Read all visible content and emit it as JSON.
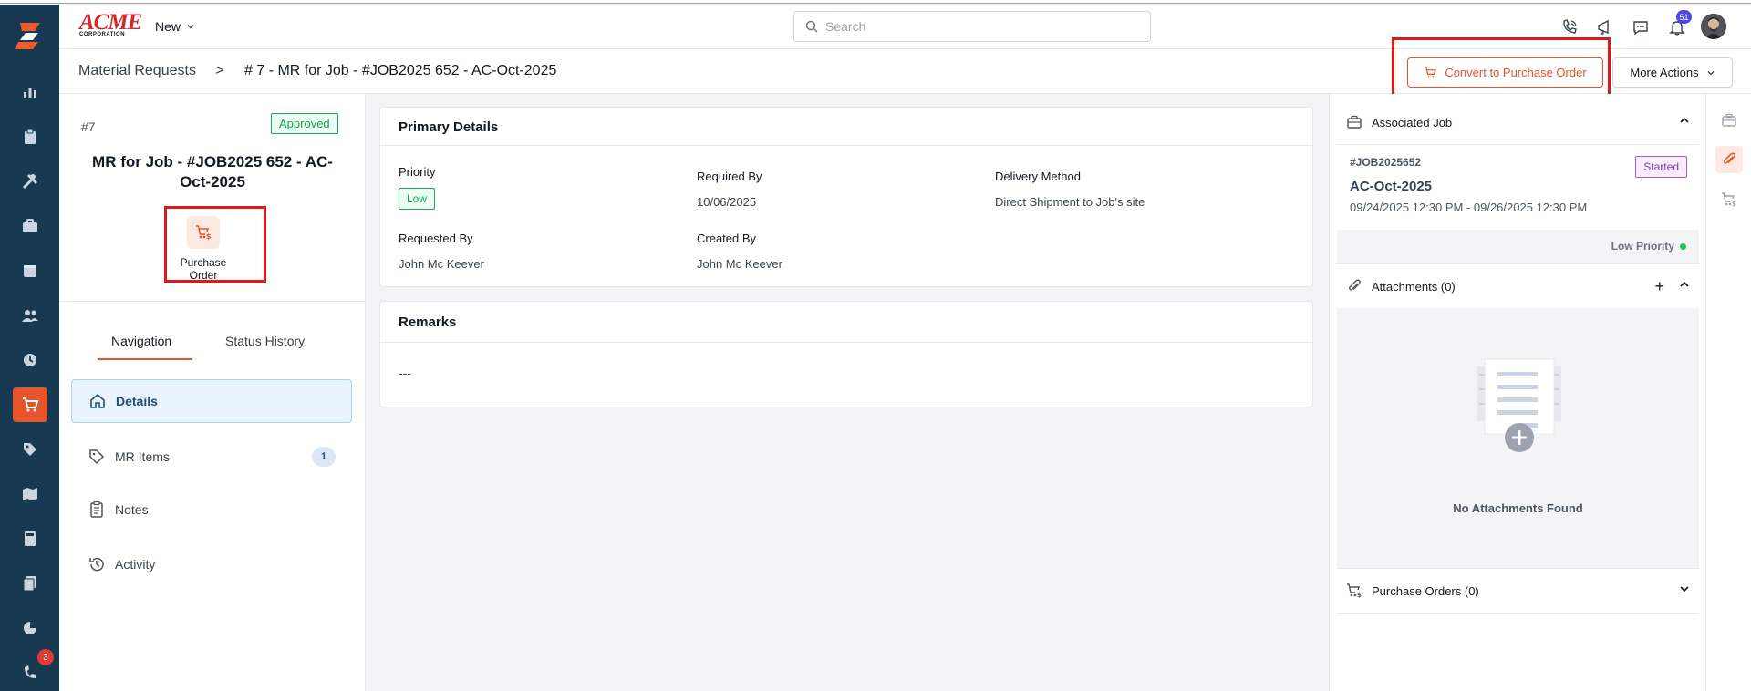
{
  "header": {
    "brand_name": "ACME",
    "brand_sub": "CORPORATION",
    "new_label": "New",
    "search_placeholder": "Search",
    "notification_count": "51"
  },
  "sidebar": {
    "items": [
      {
        "icon": "chart-icon"
      },
      {
        "icon": "clipboard-icon"
      },
      {
        "icon": "tools-icon"
      },
      {
        "icon": "briefcase-icon"
      },
      {
        "icon": "calendar-icon"
      },
      {
        "icon": "users-icon"
      },
      {
        "icon": "clock-icon"
      },
      {
        "icon": "cart-icon",
        "active": true
      },
      {
        "icon": "tag-icon"
      },
      {
        "icon": "map-icon"
      },
      {
        "icon": "calculator-icon"
      },
      {
        "icon": "documents-icon"
      },
      {
        "icon": "pie-chart-icon"
      },
      {
        "icon": "support-icon",
        "badge": "3"
      }
    ],
    "active_color": "#e8542a",
    "background": "#173a52"
  },
  "breadcrumb": {
    "root": "Material Requests",
    "separator": ">",
    "current": "# 7 - MR for Job - #JOB2025 652 - AC-Oct-2025"
  },
  "actions": {
    "convert_label": "Convert to Purchase Order",
    "more_label": "More Actions"
  },
  "left_panel": {
    "number": "#7",
    "status": "Approved",
    "title": "MR for Job - #JOB2025 652 - AC-Oct-2025",
    "po_label": "Purchase Order",
    "tabs": [
      {
        "label": "Navigation",
        "active": true
      },
      {
        "label": "Status History",
        "active": false
      }
    ],
    "nav": [
      {
        "label": "Details",
        "icon": "home-icon",
        "active": true
      },
      {
        "label": "MR Items",
        "icon": "tag-icon",
        "count": "1"
      },
      {
        "label": "Notes",
        "icon": "notes-icon"
      },
      {
        "label": "Activity",
        "icon": "history-icon"
      }
    ]
  },
  "primary_details": {
    "heading": "Primary Details",
    "priority_label": "Priority",
    "priority_value": "Low",
    "required_by_label": "Required By",
    "required_by_value": "10/06/2025",
    "delivery_label": "Delivery Method",
    "delivery_value": "Direct Shipment to Job's site",
    "requested_by_label": "Requested By",
    "requested_by_value": "John Mc Keever",
    "created_by_label": "Created By",
    "created_by_value": "John Mc Keever"
  },
  "remarks": {
    "heading": "Remarks",
    "value": "---"
  },
  "right_panel": {
    "associated_job_heading": "Associated Job",
    "job_number": "#JOB2025652",
    "job_status": "Started",
    "job_name": "AC-Oct-2025",
    "job_dates": "09/24/2025 12:30 PM - 09/26/2025 12:30 PM",
    "job_priority": "Low Priority",
    "attachments_heading": "Attachments (0)",
    "no_attachments": "No Attachments Found",
    "purchase_orders_heading": "Purchase Orders (0)"
  }
}
